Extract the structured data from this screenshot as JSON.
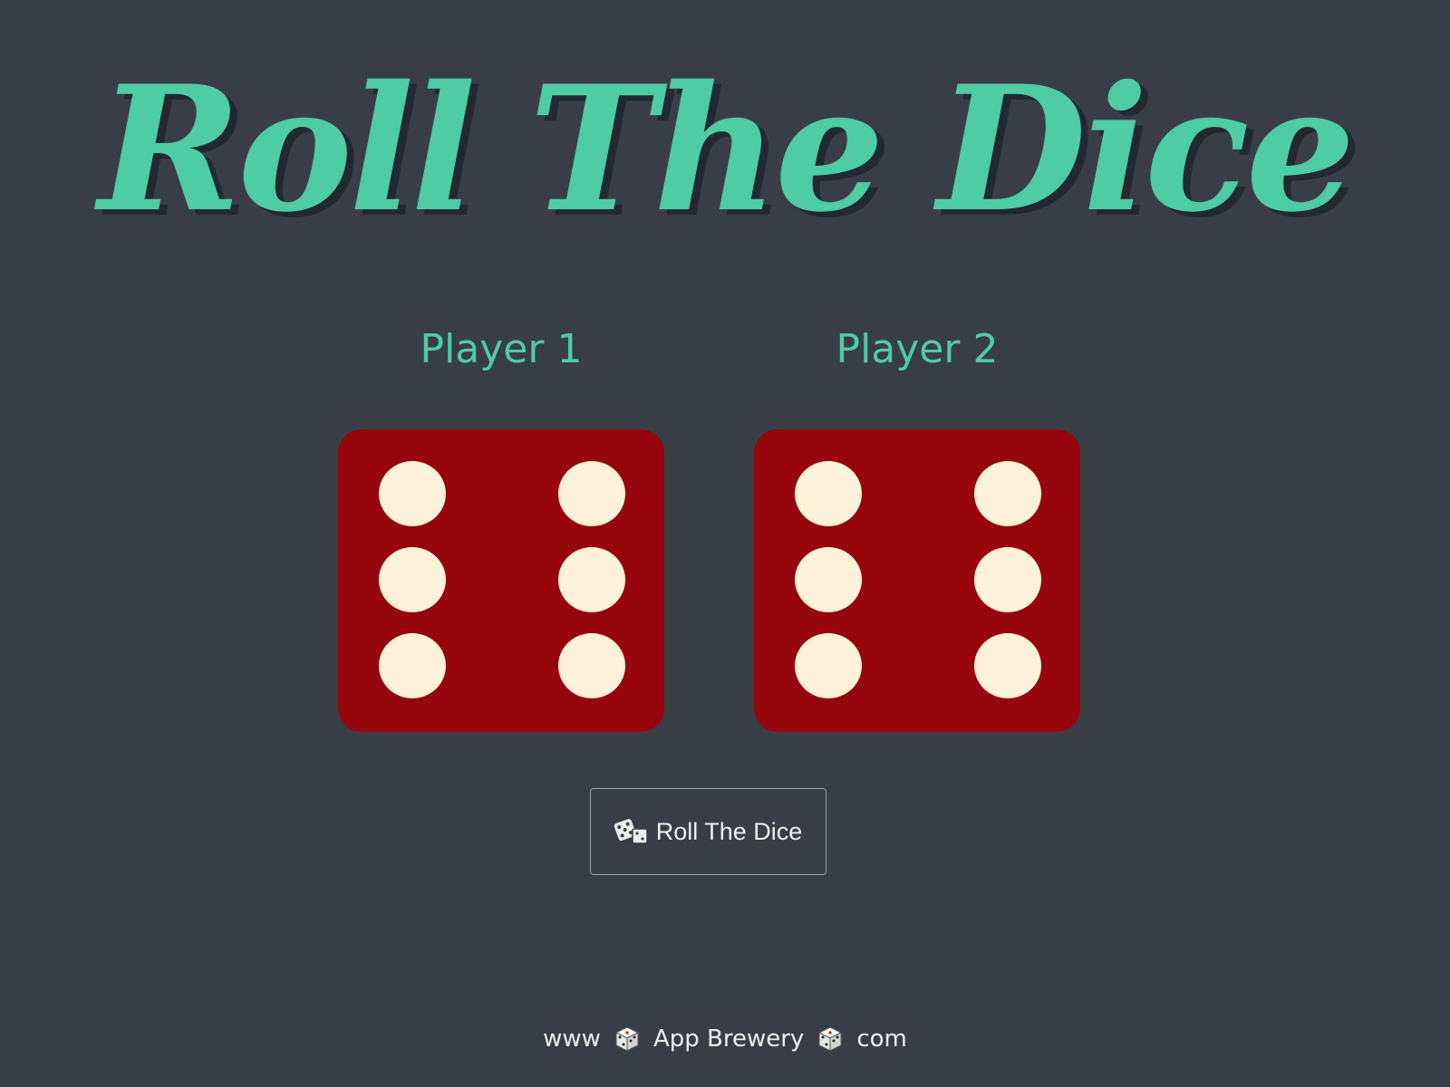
{
  "header": {
    "title": "Roll The Dice"
  },
  "players": [
    {
      "label": "Player 1",
      "die_value": 6
    },
    {
      "label": "Player 2",
      "die_value": 6
    }
  ],
  "roll_button": {
    "icon": "dice-icon",
    "label": "Roll The Dice"
  },
  "footer": {
    "part1": "www",
    "part2": "App Brewery",
    "part3": "com",
    "separator_icon": "die-icon"
  },
  "colors": {
    "background": "#393e46",
    "accent": "#4ecca3",
    "die_face": "#97060d",
    "pip": "#fdf2d9"
  }
}
